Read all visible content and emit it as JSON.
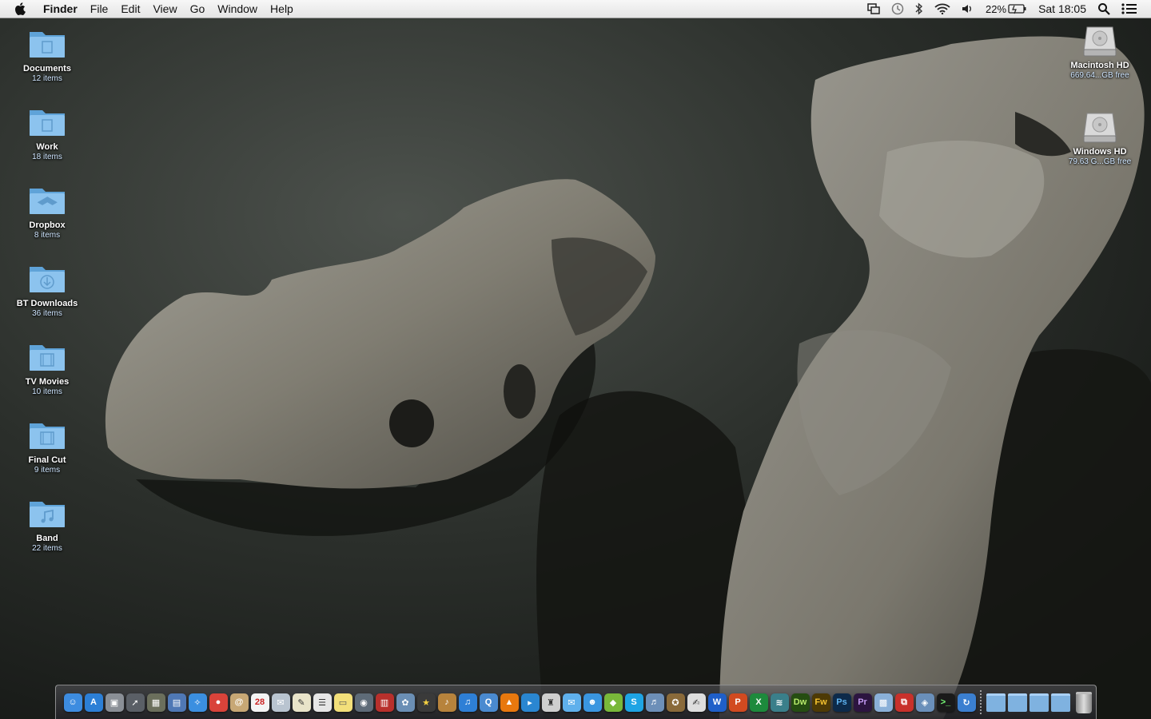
{
  "menubar": {
    "apple_icon": "apple-logo-icon",
    "app_name": "Finder",
    "menus": [
      "File",
      "Edit",
      "View",
      "Go",
      "Window",
      "Help"
    ],
    "status": {
      "battery_percent": "22%",
      "clock": "Sat 18:05",
      "icons": [
        "mirroring-icon",
        "time-machine-icon",
        "bluetooth-icon",
        "wifi-icon",
        "volume-icon",
        "battery-icon",
        "spotlight-icon",
        "notification-center-icon"
      ]
    }
  },
  "desktop": {
    "folders": [
      {
        "name": "Documents",
        "count": "12 items",
        "icon": "folder-documents-icon"
      },
      {
        "name": "Work",
        "count": "18 items",
        "icon": "folder-generic-icon"
      },
      {
        "name": "Dropbox",
        "count": "8 items",
        "icon": "folder-dropbox-icon"
      },
      {
        "name": "BT Downloads",
        "count": "36 items",
        "icon": "folder-downloads-icon"
      },
      {
        "name": "TV Movies",
        "count": "10 items",
        "icon": "folder-movies-icon"
      },
      {
        "name": "Final Cut",
        "count": "9 items",
        "icon": "folder-movies-icon"
      },
      {
        "name": "Band",
        "count": "22 items",
        "icon": "folder-music-icon"
      }
    ],
    "drives": [
      {
        "name": "Macintosh HD",
        "free": "669.64...GB free",
        "icon": "hard-drive-icon"
      },
      {
        "name": "Windows HD",
        "free": "79.63 G...GB free",
        "icon": "hard-drive-icon"
      }
    ]
  },
  "dock": {
    "apps": [
      {
        "icon": "finder-icon",
        "glyph": "☺",
        "bg": "#3d8ce0"
      },
      {
        "icon": "app-store-icon",
        "glyph": "A",
        "bg": "#2c7fd6"
      },
      {
        "icon": "screenshot-icon",
        "glyph": "▣",
        "bg": "#8a8f96"
      },
      {
        "icon": "launchpad-icon",
        "glyph": "➚",
        "bg": "#5a5f66"
      },
      {
        "icon": "dashboard-icon",
        "glyph": "▦",
        "bg": "#6b6f5c"
      },
      {
        "icon": "preview-icon",
        "glyph": "▤",
        "bg": "#4f78b5"
      },
      {
        "icon": "safari-icon",
        "glyph": "✧",
        "bg": "#3b8fe0"
      },
      {
        "icon": "chrome-icon",
        "glyph": "●",
        "bg": "#d9433a"
      },
      {
        "icon": "contacts-icon",
        "glyph": "@",
        "bg": "#c7a775"
      },
      {
        "icon": "calendar-icon",
        "glyph": "28",
        "bg": "#f4f4f4",
        "fg": "#c22"
      },
      {
        "icon": "mail-icon",
        "glyph": "✉",
        "bg": "#b9c4d0"
      },
      {
        "icon": "textedit-icon",
        "glyph": "✎",
        "bg": "#e9e4c9",
        "fg": "#333"
      },
      {
        "icon": "notes-icon",
        "glyph": "☰",
        "bg": "#e6e6e6",
        "fg": "#333"
      },
      {
        "icon": "stickies-icon",
        "glyph": "▭",
        "bg": "#f3e07a",
        "fg": "#555"
      },
      {
        "icon": "facetime-icon",
        "glyph": "◉",
        "bg": "#5e6b78"
      },
      {
        "icon": "photo-booth-icon",
        "glyph": "▥",
        "bg": "#b8302c"
      },
      {
        "icon": "iphoto-icon",
        "glyph": "✿",
        "bg": "#6b8fb5"
      },
      {
        "icon": "imovie-icon",
        "glyph": "★",
        "bg": "#3a3a3a",
        "fg": "#f5d142"
      },
      {
        "icon": "garageband-icon",
        "glyph": "♪",
        "bg": "#b7833c"
      },
      {
        "icon": "itunes-icon",
        "glyph": "♫",
        "bg": "#2e7fd6"
      },
      {
        "icon": "quicktime-icon",
        "glyph": "Q",
        "bg": "#4a8ad0"
      },
      {
        "icon": "vlc-icon",
        "glyph": "▲",
        "bg": "#e8780e"
      },
      {
        "icon": "pages-icon",
        "glyph": "▸",
        "bg": "#2a86d1"
      },
      {
        "icon": "script-icon",
        "glyph": "♜",
        "bg": "#cfcfcf",
        "fg": "#333"
      },
      {
        "icon": "messages-icon",
        "glyph": "✉",
        "bg": "#5fb0ec"
      },
      {
        "icon": "messenger-icon",
        "glyph": "☻",
        "bg": "#3a96e0"
      },
      {
        "icon": "adium-icon",
        "glyph": "◆",
        "bg": "#79b83a"
      },
      {
        "icon": "skype-icon",
        "glyph": "S",
        "bg": "#1ea4e4"
      },
      {
        "icon": "itunes-store-icon",
        "glyph": "♬",
        "bg": "#6d8fb8"
      },
      {
        "icon": "cyberduck-icon",
        "glyph": "✪",
        "bg": "#8a6a3a"
      },
      {
        "icon": "document-icon",
        "glyph": "✍",
        "bg": "#dedede",
        "fg": "#333"
      },
      {
        "icon": "word-icon",
        "glyph": "W",
        "bg": "#1f5fc9"
      },
      {
        "icon": "powerpoint-icon",
        "glyph": "P",
        "bg": "#d24a20"
      },
      {
        "icon": "excel-icon",
        "glyph": "X",
        "bg": "#1d8a3c"
      },
      {
        "icon": "finder-extra-icon",
        "glyph": "≋",
        "bg": "#3a7f8a"
      },
      {
        "icon": "dreamweaver-icon",
        "glyph": "Dw",
        "bg": "#254d12",
        "fg": "#b8ea6b"
      },
      {
        "icon": "fireworks-icon",
        "glyph": "Fw",
        "bg": "#4d3a06",
        "fg": "#f5c330"
      },
      {
        "icon": "photoshop-icon",
        "glyph": "Ps",
        "bg": "#0d2a4a",
        "fg": "#5fb3f0"
      },
      {
        "icon": "premiere-icon",
        "glyph": "Pr",
        "bg": "#2c1540",
        "fg": "#c39af2"
      },
      {
        "icon": "image-capture-icon",
        "glyph": "▩",
        "bg": "#8ab0d8"
      },
      {
        "icon": "parallels-icon",
        "glyph": "⧉",
        "bg": "#c8312b"
      },
      {
        "icon": "virtualbox-icon",
        "glyph": "◈",
        "bg": "#6a8fba"
      },
      {
        "icon": "terminal-icon",
        "glyph": ">_",
        "bg": "#1a1a1a",
        "fg": "#7f7"
      },
      {
        "icon": "sync-icon",
        "glyph": "↻",
        "bg": "#3b7fd0"
      }
    ],
    "stacks": [
      "applications-stack-icon",
      "documents-stack-icon",
      "downloads-stack-icon",
      "folder-stack-icon"
    ],
    "trash_icon": "trash-icon"
  }
}
